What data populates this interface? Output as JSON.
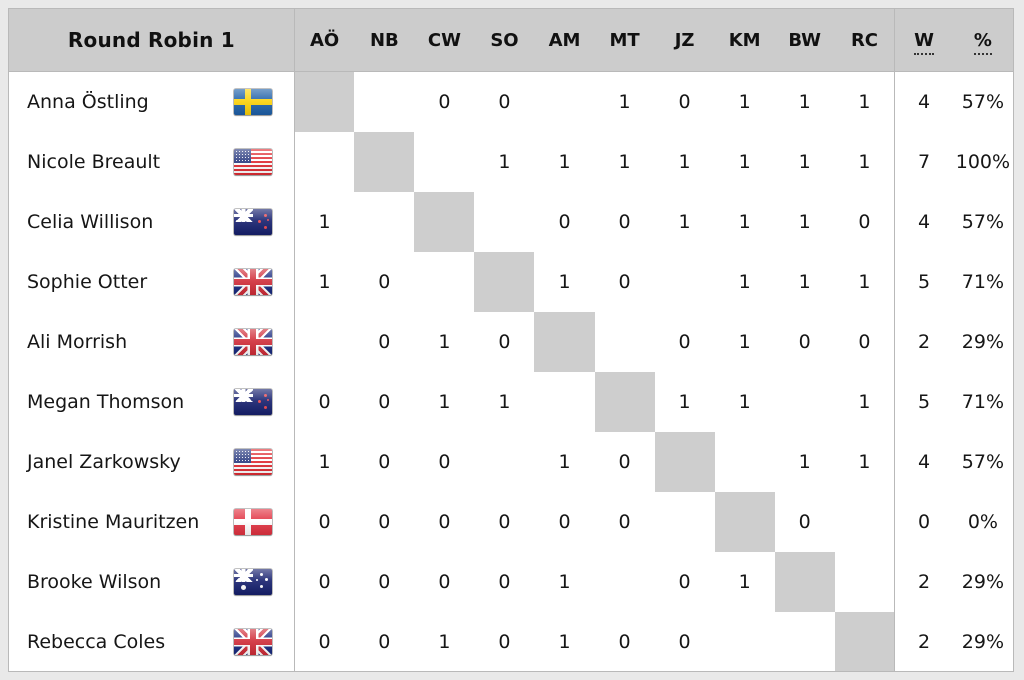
{
  "header": {
    "title": "Round Robin 1",
    "opponent_codes": [
      "AÖ",
      "NB",
      "CW",
      "SO",
      "AM",
      "MT",
      "JZ",
      "KM",
      "BW",
      "RC"
    ],
    "wins_label": "W",
    "percent_label": "%"
  },
  "rows": [
    {
      "name": "Anna Östling",
      "code": "AÖ",
      "flag": "flag-se",
      "flag_name": "flag-sweden",
      "cells": [
        "diag",
        "",
        "0",
        "0",
        "",
        "1",
        "0",
        "1",
        "1",
        "1"
      ],
      "wins": "4",
      "percent": "57%"
    },
    {
      "name": "Nicole Breault",
      "code": "NB",
      "flag": "flag-us",
      "flag_name": "flag-united-states",
      "cells": [
        "",
        "diag",
        "",
        "1",
        "1",
        "1",
        "1",
        "1",
        "1",
        "1"
      ],
      "wins": "7",
      "percent": "100%"
    },
    {
      "name": "Celia Willison",
      "code": "CW",
      "flag": "flag-nz",
      "flag_name": "flag-new-zealand",
      "cells": [
        "1",
        "",
        "diag",
        "",
        "0",
        "0",
        "1",
        "1",
        "1",
        "0"
      ],
      "wins": "4",
      "percent": "57%"
    },
    {
      "name": "Sophie Otter",
      "code": "SO",
      "flag": "flag-gb",
      "flag_name": "flag-united-kingdom",
      "cells": [
        "1",
        "0",
        "",
        "diag",
        "1",
        "0",
        "",
        "1",
        "1",
        "1"
      ],
      "wins": "5",
      "percent": "71%"
    },
    {
      "name": "Ali Morrish",
      "code": "AM",
      "flag": "flag-gb",
      "flag_name": "flag-united-kingdom",
      "cells": [
        "",
        "0",
        "1",
        "0",
        "diag",
        "",
        "0",
        "1",
        "0",
        "0"
      ],
      "wins": "2",
      "percent": "29%"
    },
    {
      "name": "Megan Thomson",
      "code": "MT",
      "flag": "flag-nz",
      "flag_name": "flag-new-zealand",
      "cells": [
        "0",
        "0",
        "1",
        "1",
        "",
        "diag",
        "1",
        "1",
        "",
        "1"
      ],
      "wins": "5",
      "percent": "71%"
    },
    {
      "name": "Janel Zarkowsky",
      "code": "JZ",
      "flag": "flag-us",
      "flag_name": "flag-united-states",
      "cells": [
        "1",
        "0",
        "0",
        "",
        "1",
        "0",
        "diag",
        "",
        "1",
        "1"
      ],
      "wins": "4",
      "percent": "57%"
    },
    {
      "name": "Kristine Mauritzen",
      "code": "KM",
      "flag": "flag-dk",
      "flag_name": "flag-denmark",
      "cells": [
        "0",
        "0",
        "0",
        "0",
        "0",
        "0",
        "",
        "diag",
        "0",
        ""
      ],
      "wins": "0",
      "percent": "0%"
    },
    {
      "name": "Brooke Wilson",
      "code": "BW",
      "flag": "flag-au",
      "flag_name": "flag-australia",
      "cells": [
        "0",
        "0",
        "0",
        "0",
        "1",
        "",
        "0",
        "1",
        "diag",
        ""
      ],
      "wins": "2",
      "percent": "29%"
    },
    {
      "name": "Rebecca Coles",
      "code": "RC",
      "flag": "flag-gb",
      "flag_name": "flag-united-kingdom",
      "cells": [
        "0",
        "0",
        "1",
        "0",
        "1",
        "0",
        "0",
        "",
        "",
        "diag"
      ],
      "wins": "2",
      "percent": "29%"
    }
  ],
  "colors": {
    "page_background": "#e9e9e9",
    "header_background": "#cccccc",
    "diagonal_cell": "#cecece",
    "border": "#b9b9b9",
    "text": "#161616"
  }
}
